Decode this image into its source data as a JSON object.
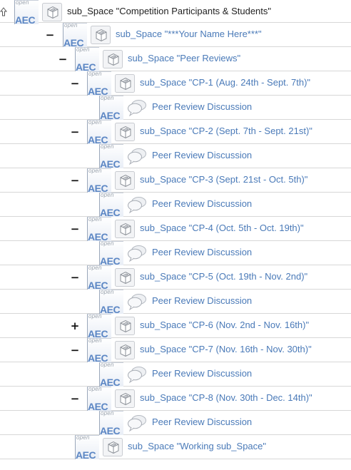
{
  "tree": {
    "root": {
      "label": "sub_Space \"Competition Participants & Students\""
    },
    "your_name": {
      "label": "sub_Space \"***Your Name Here***\"",
      "toggle": "−"
    },
    "peer_reviews": {
      "label": "sub_Space \"Peer Reviews\"",
      "toggle": "−"
    },
    "badge": {
      "open": "open",
      "aec": "AEC"
    },
    "cps": [
      {
        "label": "sub_Space \"CP-1 (Aug. 24th - Sept. 7th)\"",
        "toggle": "−",
        "discussion": "Peer Review Discussion"
      },
      {
        "label": "sub_Space \"CP-2 (Sept. 7th - Sept. 21st)\"",
        "toggle": "−",
        "discussion": "Peer Review Discussion"
      },
      {
        "label": "sub_Space \"CP-3 (Sept. 21st - Oct. 5th)\"",
        "toggle": "−",
        "discussion": "Peer Review Discussion"
      },
      {
        "label": "sub_Space \"CP-4 (Oct. 5th - Oct. 19th)\"",
        "toggle": "−",
        "discussion": "Peer Review Discussion"
      },
      {
        "label": "sub_Space \"CP-5 (Oct. 19th - Nov. 2nd)\"",
        "toggle": "−",
        "discussion": "Peer Review Discussion"
      },
      {
        "label": "sub_Space \"CP-6 (Nov. 2nd - Nov. 16th)\"",
        "toggle": "+"
      },
      {
        "label": "sub_Space \"CP-7 (Nov. 16th - Nov. 30th)\"",
        "toggle": "−",
        "discussion": "Peer Review Discussion"
      },
      {
        "label": "sub_Space \"CP-8 (Nov. 30th - Dec. 14th)\"",
        "toggle": "−",
        "discussion": "Peer Review Discussion"
      }
    ],
    "working": {
      "label": "sub_Space \"Working sub_Space\""
    }
  },
  "colors": {
    "link": "#4a7ab8",
    "aec": "#5b86c4",
    "divider": "#d7d7d7"
  },
  "icons": {
    "up": "arrow-up-icon",
    "space": "space-box-icon",
    "discussion": "speech-bubbles-icon"
  }
}
